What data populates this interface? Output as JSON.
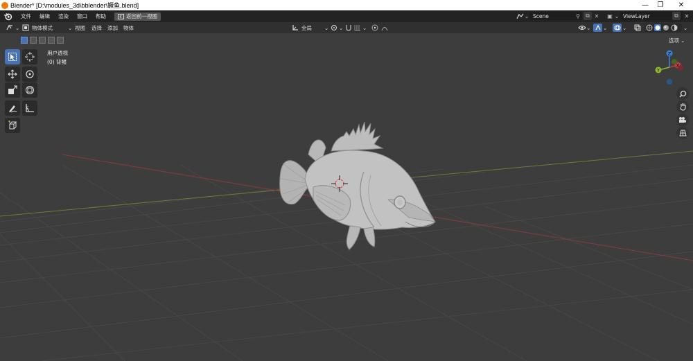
{
  "window": {
    "title": "Blender* [D:\\modules_3d\\bblender\\鳜鱼.blend]",
    "controls": {
      "minimize": "—",
      "maximize": "❐",
      "close": "✕"
    }
  },
  "menubar": {
    "items": [
      "文件",
      "编辑",
      "渲染",
      "窗口",
      "帮助"
    ],
    "back_button": "返回前一视图",
    "scene": "Scene",
    "view_layer": "ViewLayer"
  },
  "header": {
    "mode": "物体模式",
    "menus": [
      "视图",
      "选择",
      "添加",
      "物体"
    ],
    "transform_orientation": "全局",
    "options": "选项"
  },
  "viewport": {
    "view_name": "用户透视",
    "collection_label": "(0) 背鳍"
  },
  "gizmo": {
    "x": "X",
    "y": "Y",
    "z": "Z"
  },
  "colors": {
    "active_tool": "#4772b3",
    "x_axis": "#c23c46",
    "y_axis": "#8fb92b",
    "z_axis": "#3e7ed6"
  },
  "tools": [
    "select-box-tool",
    "cursor-tool",
    "move-tool",
    "rotate-tool",
    "scale-tool",
    "transform-tool",
    "annotate-tool",
    "measure-tool",
    "add-cube-tool"
  ]
}
